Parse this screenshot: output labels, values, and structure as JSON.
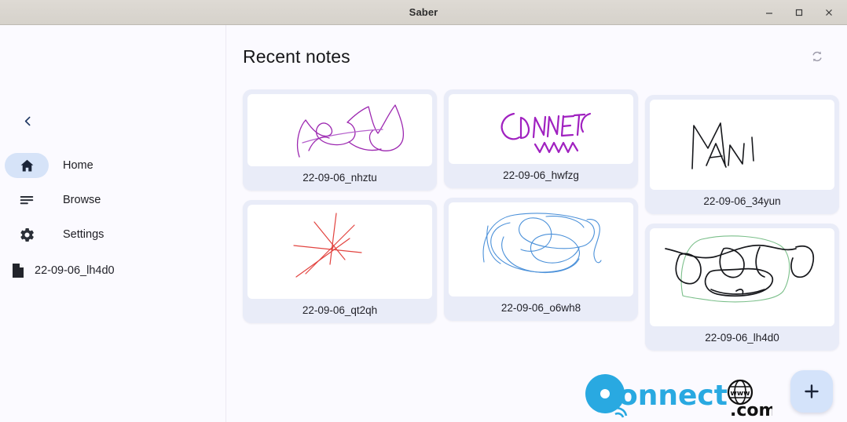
{
  "window": {
    "title": "Saber",
    "controls": {
      "minimize": "minimize",
      "maximize": "maximize",
      "close": "close"
    }
  },
  "sidebar": {
    "back_label": "back",
    "items": [
      {
        "label": "Home",
        "icon": "home-icon",
        "active": true
      },
      {
        "label": "Browse",
        "icon": "browse-icon",
        "active": false
      },
      {
        "label": "Settings",
        "icon": "settings-icon",
        "active": false
      }
    ],
    "file": {
      "label": "22-09-06_lh4d0",
      "icon": "file-icon"
    }
  },
  "main": {
    "title": "Recent notes",
    "refresh_icon": "sync-icon",
    "columns": [
      {
        "cards": [
          {
            "label": "22-09-06_nhztu",
            "ink": "#9c27b0",
            "thumb": "scribble-purple",
            "thumb_h": 92
          },
          {
            "label": "22-09-06_qt2qh",
            "ink": "#e2433f",
            "thumb": "star-red",
            "thumb_h": 120
          }
        ]
      },
      {
        "cards": [
          {
            "label": "22-09-06_hwfzg",
            "ink": "#a021c0",
            "thumb": "connect-purple",
            "thumb_h": 89
          },
          {
            "label": "22-09-06_o6wh8",
            "ink": "#4a90d9",
            "thumb": "loops-blue",
            "thumb_h": 120
          }
        ]
      },
      {
        "cards": [
          {
            "label": "22-09-06_34yun",
            "ink": "#17181c",
            "thumb": "mani-black",
            "thumb_h": 115
          },
          {
            "label": "22-09-06_lh4d0",
            "ink": "#17181c",
            "thumb": "scribble-mixed",
            "thumb_h": 125
          }
        ]
      }
    ]
  },
  "watermark": {
    "brand": "onnect",
    "suffix": ".com",
    "www": "www",
    "brand_color": "#29a9e1",
    "suffix_color": "#111111"
  },
  "fab": {
    "label": "+",
    "name": "new-note-button",
    "color": "#d4e3fa"
  }
}
